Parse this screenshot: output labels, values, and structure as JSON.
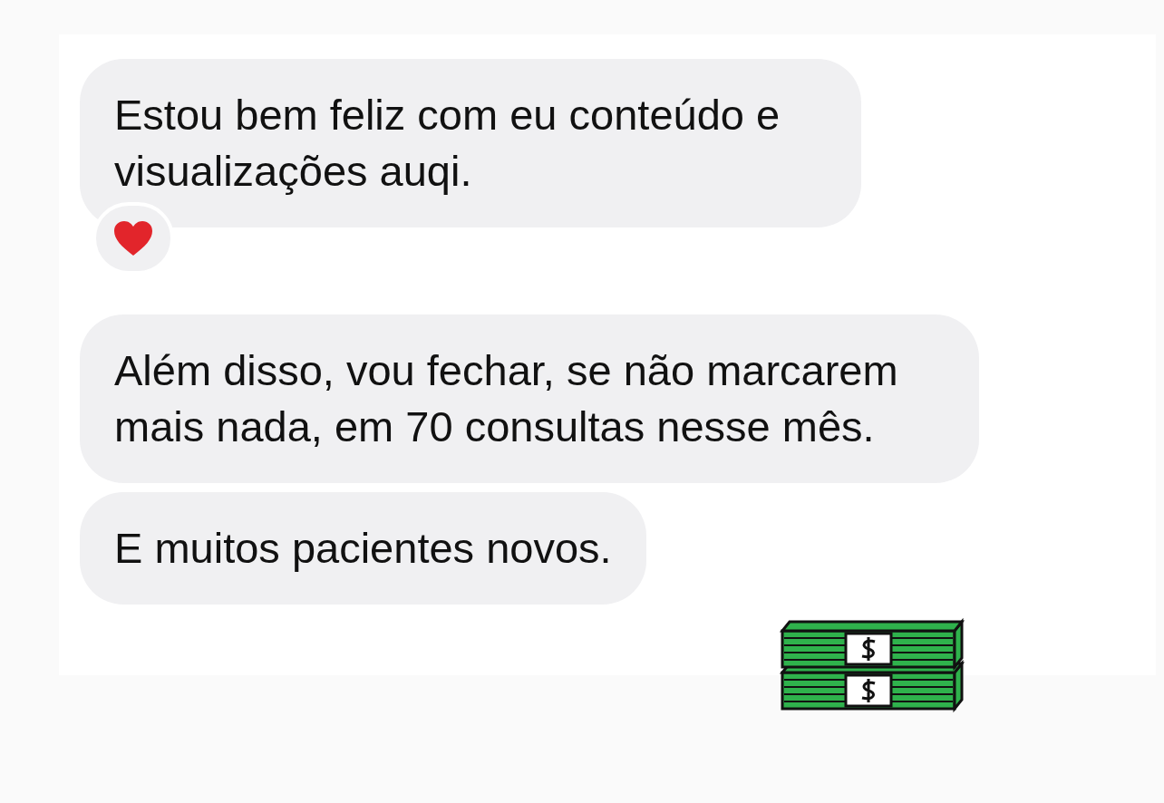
{
  "messages": [
    {
      "text": "Estou bem feliz com eu conteúdo e visualizações auqi.",
      "reacted": true
    },
    {
      "text": "Além disso, vou fechar, se não marcarem mais nada, em 70 consultas nesse mês.",
      "reacted": false
    },
    {
      "text": "E muitos pacientes novos.",
      "reacted": false
    }
  ]
}
